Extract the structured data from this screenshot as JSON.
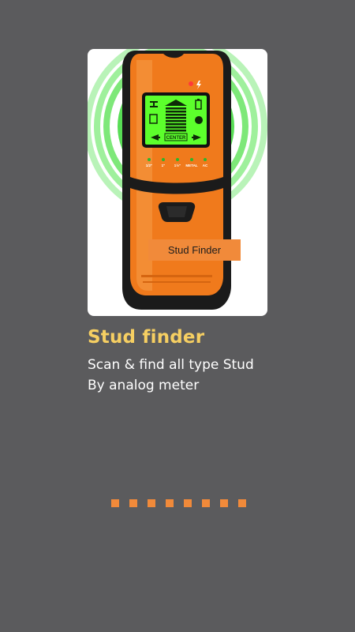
{
  "onboarding": {
    "device_label": "Stud Finder",
    "title": "Stud finder",
    "subtitle_line1": "Scan & find all type Stud",
    "subtitle_line2": "By analog meter",
    "page_count": 8,
    "page_dot_color": "#f18a3a"
  },
  "device_screen": {
    "center_text": "CENTER",
    "indicators": [
      "1/2\"",
      "1\"",
      "1½\"",
      "METAL",
      "AC"
    ]
  },
  "colors": {
    "background": "#5b5b5d",
    "title": "#f6cf62",
    "accent": "#f18a3a",
    "lcd": "#5cff2c"
  },
  "icons": {
    "scan_glow": "radar-rings-icon",
    "power": "lightning-icon"
  }
}
